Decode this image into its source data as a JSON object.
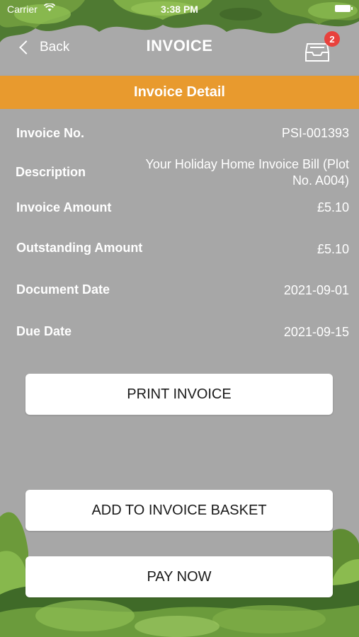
{
  "status_bar": {
    "carrier": "Carrier",
    "time": "3:38 PM"
  },
  "nav": {
    "back_label": "Back",
    "title": "INVOICE",
    "basket_count": "2"
  },
  "section": {
    "header": "Invoice Detail"
  },
  "details": [
    {
      "label": "Invoice No.",
      "value": "PSI-001393"
    },
    {
      "label": "Description",
      "value_line1": "Your Holiday Home Invoice Bill (Plot",
      "value_line2": "No. A004)"
    },
    {
      "label": "Invoice Amount",
      "value": "£5.10"
    },
    {
      "label": "Outstanding Amount",
      "value": "£5.10"
    },
    {
      "label": "Document Date",
      "value": "2021-09-01"
    },
    {
      "label": "Due Date",
      "value": "2021-09-15"
    }
  ],
  "buttons": {
    "print": "PRINT INVOICE",
    "add_basket": "ADD TO INVOICE BASKET",
    "pay_now": "PAY NOW"
  },
  "colors": {
    "background": "#a7a7a7",
    "header_bar": "#e89a2e",
    "badge": "#e8413c",
    "button_bg": "#ffffff"
  }
}
